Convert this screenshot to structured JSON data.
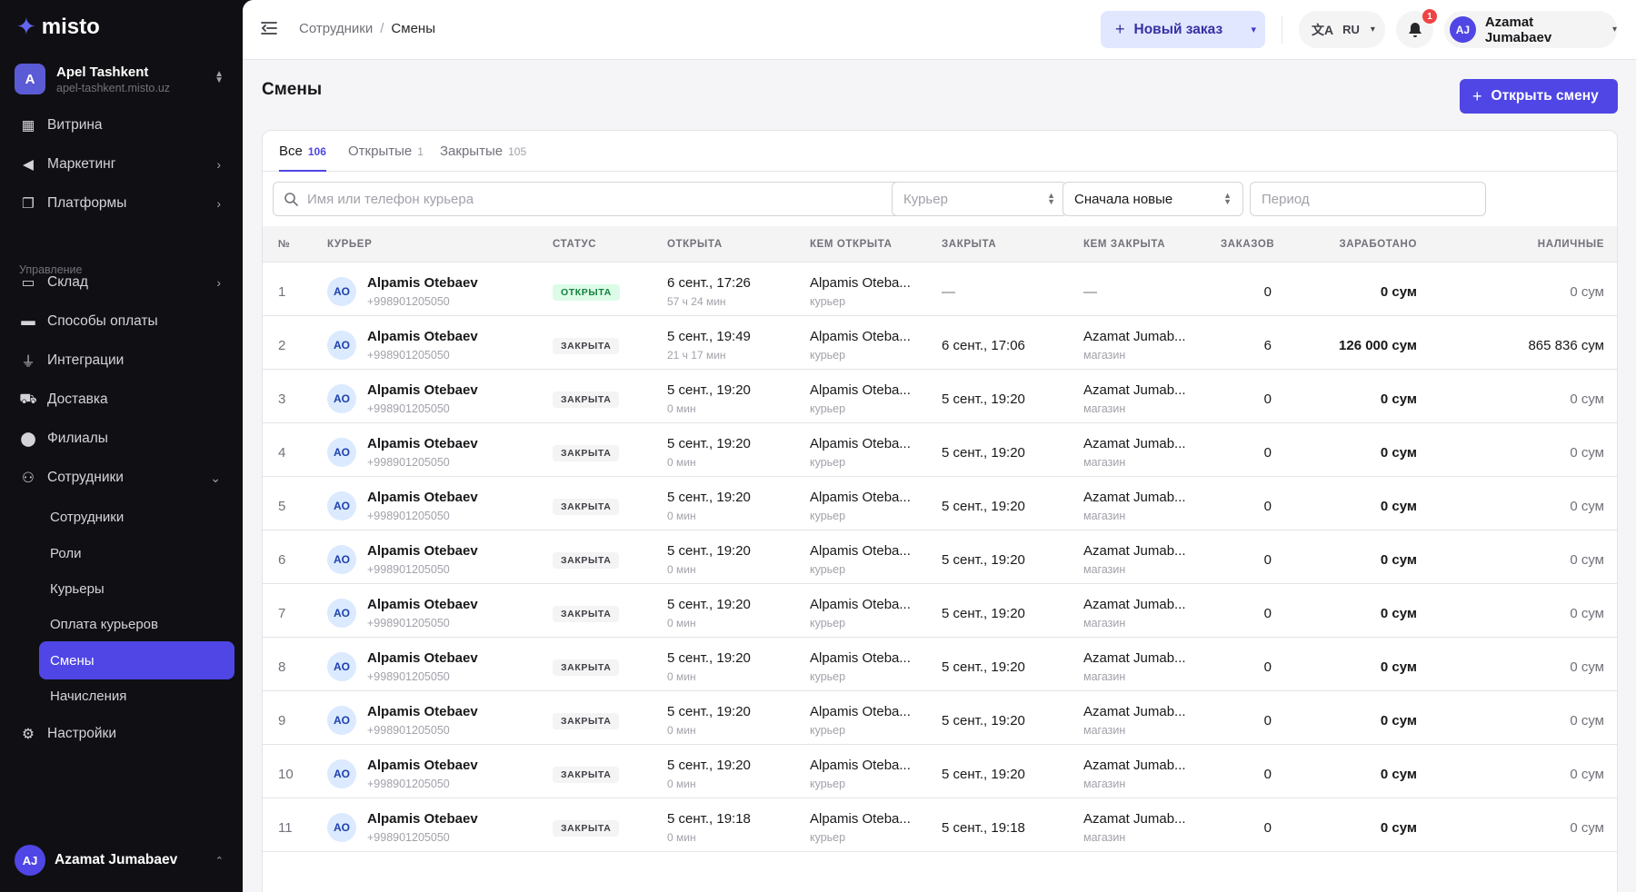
{
  "brand": {
    "name": "misto"
  },
  "org": {
    "badge": "A",
    "name": "Apel Tashkent",
    "domain": "apel-tashkent.misto.uz"
  },
  "sidebar": {
    "items": [
      {
        "label": "Витрина",
        "icon": "grid-icon"
      },
      {
        "label": "Маркетинг",
        "icon": "megaphone-icon",
        "chevron": true
      },
      {
        "label": "Платформы",
        "icon": "copy-icon",
        "chevron": true
      }
    ],
    "section_label": "Управление",
    "manage_items": [
      {
        "label": "Склад",
        "icon": "box-icon",
        "chevron": true
      },
      {
        "label": "Способы оплаты",
        "icon": "card-icon"
      },
      {
        "label": "Интеграции",
        "icon": "plug-icon"
      },
      {
        "label": "Доставка",
        "icon": "truck-icon"
      },
      {
        "label": "Филиалы",
        "icon": "pin-icon"
      },
      {
        "label": "Сотрудники",
        "icon": "users-icon",
        "expanded": true
      }
    ],
    "sub_items": [
      "Сотрудники",
      "Роли",
      "Курьеры",
      "Оплата курьеров",
      "Смены",
      "Начисления"
    ],
    "active_sub": "Смены",
    "settings_label": "Настройки",
    "user": {
      "initials": "AJ",
      "name": "Azamat Jumabaev"
    }
  },
  "topbar": {
    "breadcrumb": {
      "parent": "Сотрудники",
      "separator": "/",
      "current": "Смены"
    },
    "new_order": "Новый заказ",
    "lang": "RU",
    "notifications": "1",
    "user": {
      "initials": "AJ",
      "name": "Azamat Jumabaev"
    }
  },
  "page": {
    "title": "Смены",
    "open_shift": "Открыть смену"
  },
  "tabs": [
    {
      "label": "Все",
      "count": "106",
      "active": true
    },
    {
      "label": "Открытые",
      "count": "1"
    },
    {
      "label": "Закрытые",
      "count": "105"
    }
  ],
  "filters": {
    "search_placeholder": "Имя или телефон курьера",
    "courier_placeholder": "Курьер",
    "sort_value": "Сначала новые",
    "period_placeholder": "Период"
  },
  "table": {
    "headers": [
      "№",
      "КУРЬЕР",
      "СТАТУС",
      "ОТКРЫТА",
      "КЕМ ОТКРЫТА",
      "ЗАКРЫТА",
      "КЕМ ЗАКРЫТА",
      "ЗАКАЗОВ",
      "ЗАРАБОТАНО",
      "НАЛИЧНЫЕ"
    ],
    "rows": [
      {
        "n": "1",
        "initials": "AO",
        "name": "Alpamis Otebaev",
        "phone": "+998901205050",
        "status": "ОТКРЫТА",
        "status_type": "open",
        "opened": "6 сент., 17:26",
        "duration": "57 ч 24 мин",
        "opened_by": "Alpamis Oteba...",
        "opened_role": "курьер",
        "closed": "—",
        "closed_by": "—",
        "closed_role": "",
        "orders": "0",
        "earned": "0 сум",
        "cash": "0 сум"
      },
      {
        "n": "2",
        "initials": "AO",
        "name": "Alpamis Otebaev",
        "phone": "+998901205050",
        "status": "ЗАКРЫТА",
        "status_type": "closed",
        "opened": "5 сент., 19:49",
        "duration": "21 ч 17 мин",
        "opened_by": "Alpamis Oteba...",
        "opened_role": "курьер",
        "closed": "6 сент., 17:06",
        "closed_by": "Azamat Jumab...",
        "closed_role": "магазин",
        "orders": "6",
        "earned": "126 000 сум",
        "cash": "865 836 сум"
      },
      {
        "n": "3",
        "initials": "AO",
        "name": "Alpamis Otebaev",
        "phone": "+998901205050",
        "status": "ЗАКРЫТА",
        "status_type": "closed",
        "opened": "5 сент., 19:20",
        "duration": "0 мин",
        "opened_by": "Alpamis Oteba...",
        "opened_role": "курьер",
        "closed": "5 сент., 19:20",
        "closed_by": "Azamat Jumab...",
        "closed_role": "магазин",
        "orders": "0",
        "earned": "0 сум",
        "cash": "0 сум"
      },
      {
        "n": "4",
        "initials": "AO",
        "name": "Alpamis Otebaev",
        "phone": "+998901205050",
        "status": "ЗАКРЫТА",
        "status_type": "closed",
        "opened": "5 сент., 19:20",
        "duration": "0 мин",
        "opened_by": "Alpamis Oteba...",
        "opened_role": "курьер",
        "closed": "5 сент., 19:20",
        "closed_by": "Azamat Jumab...",
        "closed_role": "магазин",
        "orders": "0",
        "earned": "0 сум",
        "cash": "0 сум"
      },
      {
        "n": "5",
        "initials": "AO",
        "name": "Alpamis Otebaev",
        "phone": "+998901205050",
        "status": "ЗАКРЫТА",
        "status_type": "closed",
        "opened": "5 сент., 19:20",
        "duration": "0 мин",
        "opened_by": "Alpamis Oteba...",
        "opened_role": "курьер",
        "closed": "5 сент., 19:20",
        "closed_by": "Azamat Jumab...",
        "closed_role": "магазин",
        "orders": "0",
        "earned": "0 сум",
        "cash": "0 сум"
      },
      {
        "n": "6",
        "initials": "AO",
        "name": "Alpamis Otebaev",
        "phone": "+998901205050",
        "status": "ЗАКРЫТА",
        "status_type": "closed",
        "opened": "5 сент., 19:20",
        "duration": "0 мин",
        "opened_by": "Alpamis Oteba...",
        "opened_role": "курьер",
        "closed": "5 сент., 19:20",
        "closed_by": "Azamat Jumab...",
        "closed_role": "магазин",
        "orders": "0",
        "earned": "0 сум",
        "cash": "0 сум"
      },
      {
        "n": "7",
        "initials": "AO",
        "name": "Alpamis Otebaev",
        "phone": "+998901205050",
        "status": "ЗАКРЫТА",
        "status_type": "closed",
        "opened": "5 сент., 19:20",
        "duration": "0 мин",
        "opened_by": "Alpamis Oteba...",
        "opened_role": "курьер",
        "closed": "5 сент., 19:20",
        "closed_by": "Azamat Jumab...",
        "closed_role": "магазин",
        "orders": "0",
        "earned": "0 сум",
        "cash": "0 сум"
      },
      {
        "n": "8",
        "initials": "AO",
        "name": "Alpamis Otebaev",
        "phone": "+998901205050",
        "status": "ЗАКРЫТА",
        "status_type": "closed",
        "opened": "5 сент., 19:20",
        "duration": "0 мин",
        "opened_by": "Alpamis Oteba...",
        "opened_role": "курьер",
        "closed": "5 сент., 19:20",
        "closed_by": "Azamat Jumab...",
        "closed_role": "магазин",
        "orders": "0",
        "earned": "0 сум",
        "cash": "0 сум"
      },
      {
        "n": "9",
        "initials": "AO",
        "name": "Alpamis Otebaev",
        "phone": "+998901205050",
        "status": "ЗАКРЫТА",
        "status_type": "closed",
        "opened": "5 сент., 19:20",
        "duration": "0 мин",
        "opened_by": "Alpamis Oteba...",
        "opened_role": "курьер",
        "closed": "5 сент., 19:20",
        "closed_by": "Azamat Jumab...",
        "closed_role": "магазин",
        "orders": "0",
        "earned": "0 сум",
        "cash": "0 сум"
      },
      {
        "n": "10",
        "initials": "AO",
        "name": "Alpamis Otebaev",
        "phone": "+998901205050",
        "status": "ЗАКРЫТА",
        "status_type": "closed",
        "opened": "5 сент., 19:20",
        "duration": "0 мин",
        "opened_by": "Alpamis Oteba...",
        "opened_role": "курьер",
        "closed": "5 сент., 19:20",
        "closed_by": "Azamat Jumab...",
        "closed_role": "магазин",
        "orders": "0",
        "earned": "0 сум",
        "cash": "0 сум"
      },
      {
        "n": "11",
        "initials": "AO",
        "name": "Alpamis Otebaev",
        "phone": "+998901205050",
        "status": "ЗАКРЫТА",
        "status_type": "closed",
        "opened": "5 сент., 19:18",
        "duration": "0 мин",
        "opened_by": "Alpamis Oteba...",
        "opened_role": "курьер",
        "closed": "5 сент., 19:18",
        "closed_by": "Azamat Jumab...",
        "closed_role": "магазин",
        "orders": "0",
        "earned": "0 сум",
        "cash": "0 сум"
      }
    ]
  },
  "colors": {
    "accent": "#4f46e5",
    "sidebar_bg": "#101014",
    "open_status": "#15803d"
  }
}
